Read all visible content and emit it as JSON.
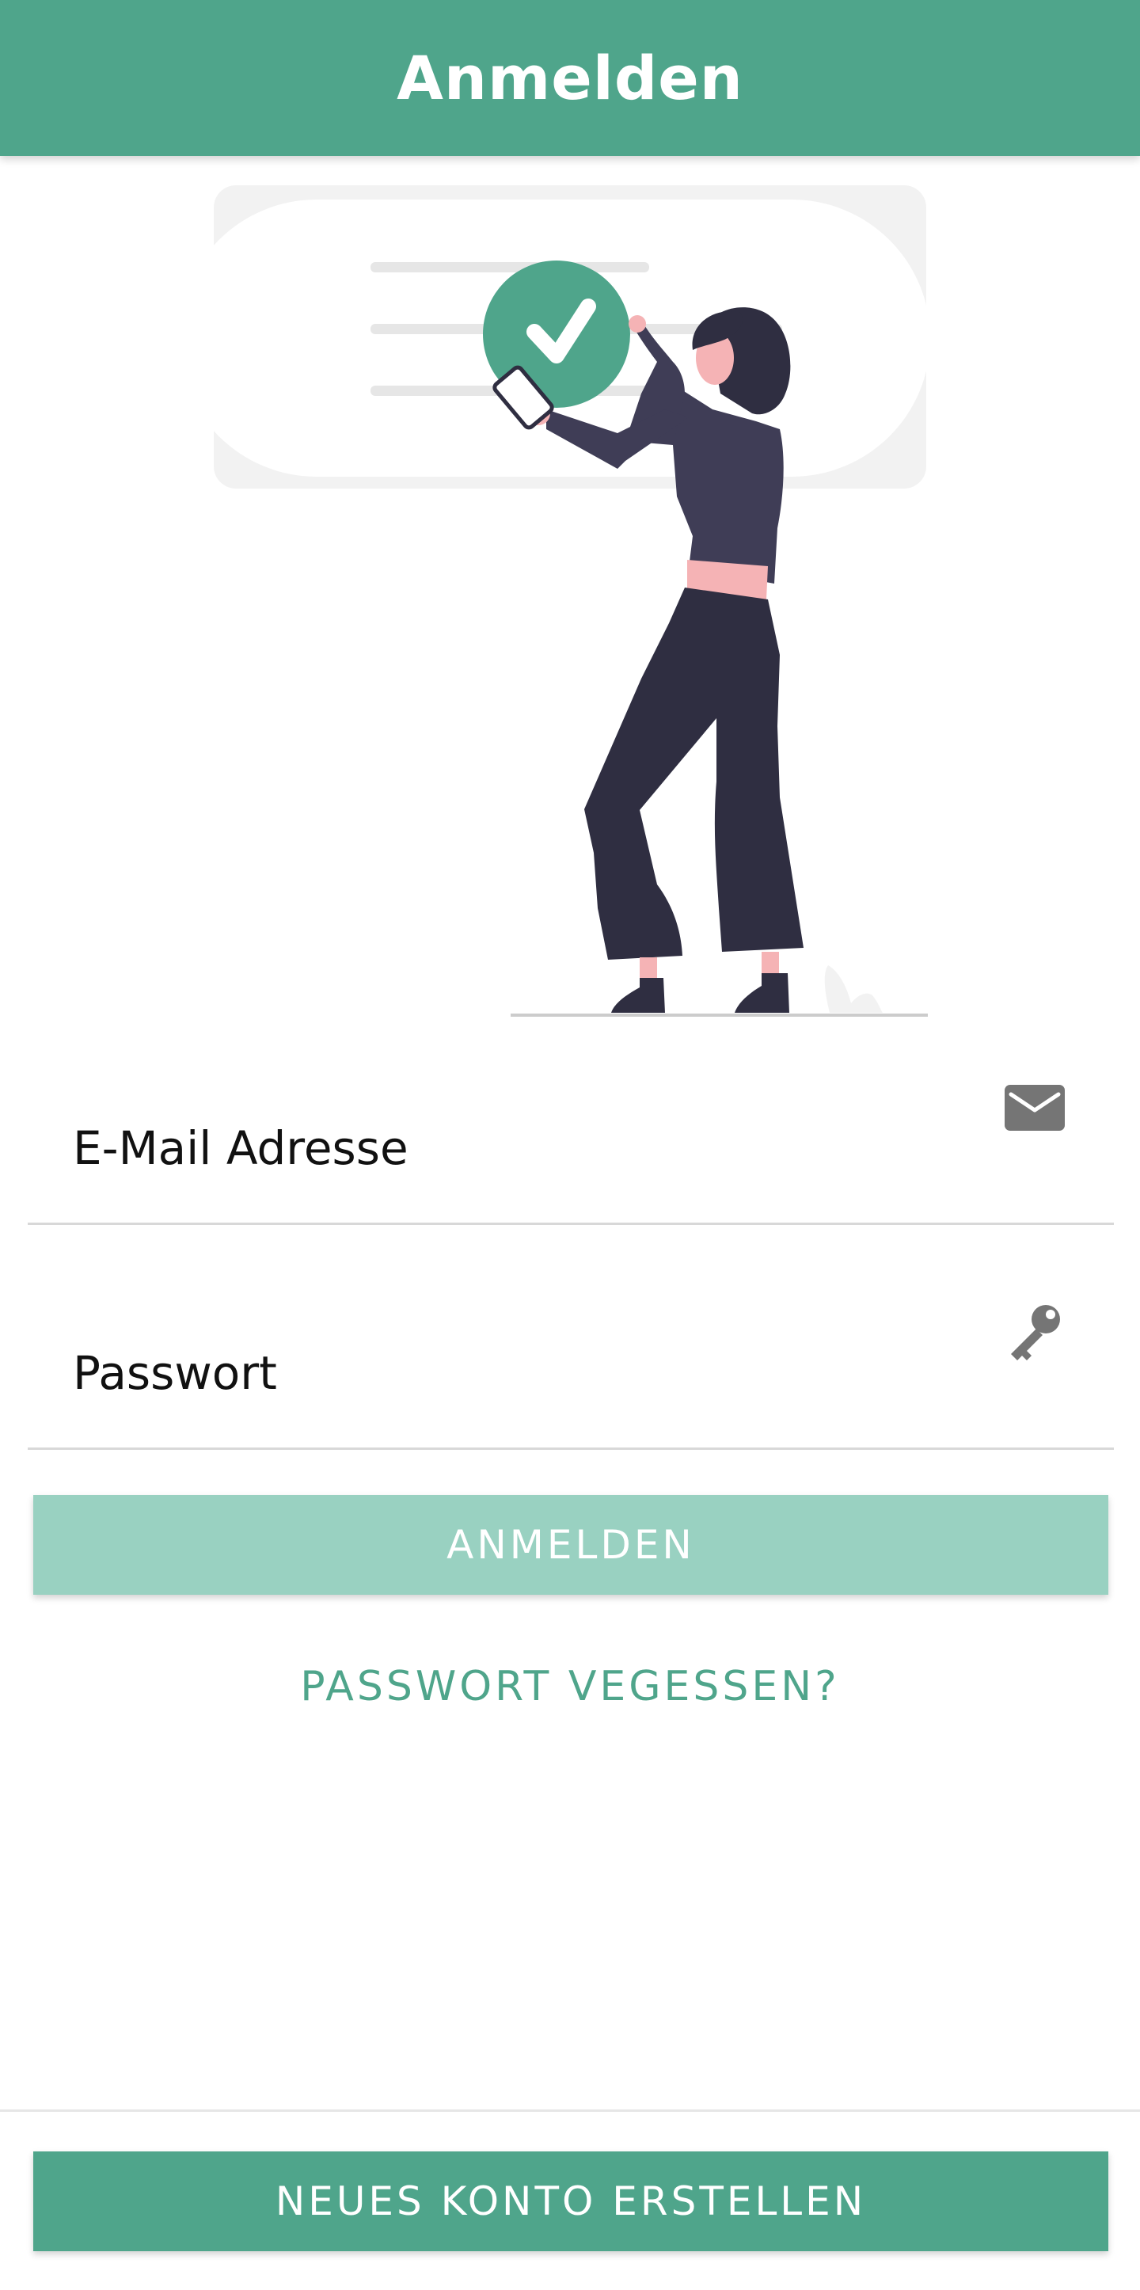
{
  "header": {
    "title": "Anmelden"
  },
  "form": {
    "email": {
      "placeholder": "E-Mail Adresse",
      "value": "",
      "icon": "envelope-icon"
    },
    "password": {
      "placeholder": "Passwort",
      "value": "",
      "icon": "key-icon"
    },
    "login_label": "ANMELDEN",
    "forgot_label": "PASSWORT VEGESSEN?"
  },
  "footer": {
    "create_account_label": "NEUES KONTO ERSTELLEN"
  },
  "colors": {
    "primary": "#4fa58b",
    "primary_light": "#99d1c1",
    "figure_dark": "#2f2e41",
    "figure_skin": "#f5b3b5",
    "card_bg": "#f2f2f2"
  }
}
